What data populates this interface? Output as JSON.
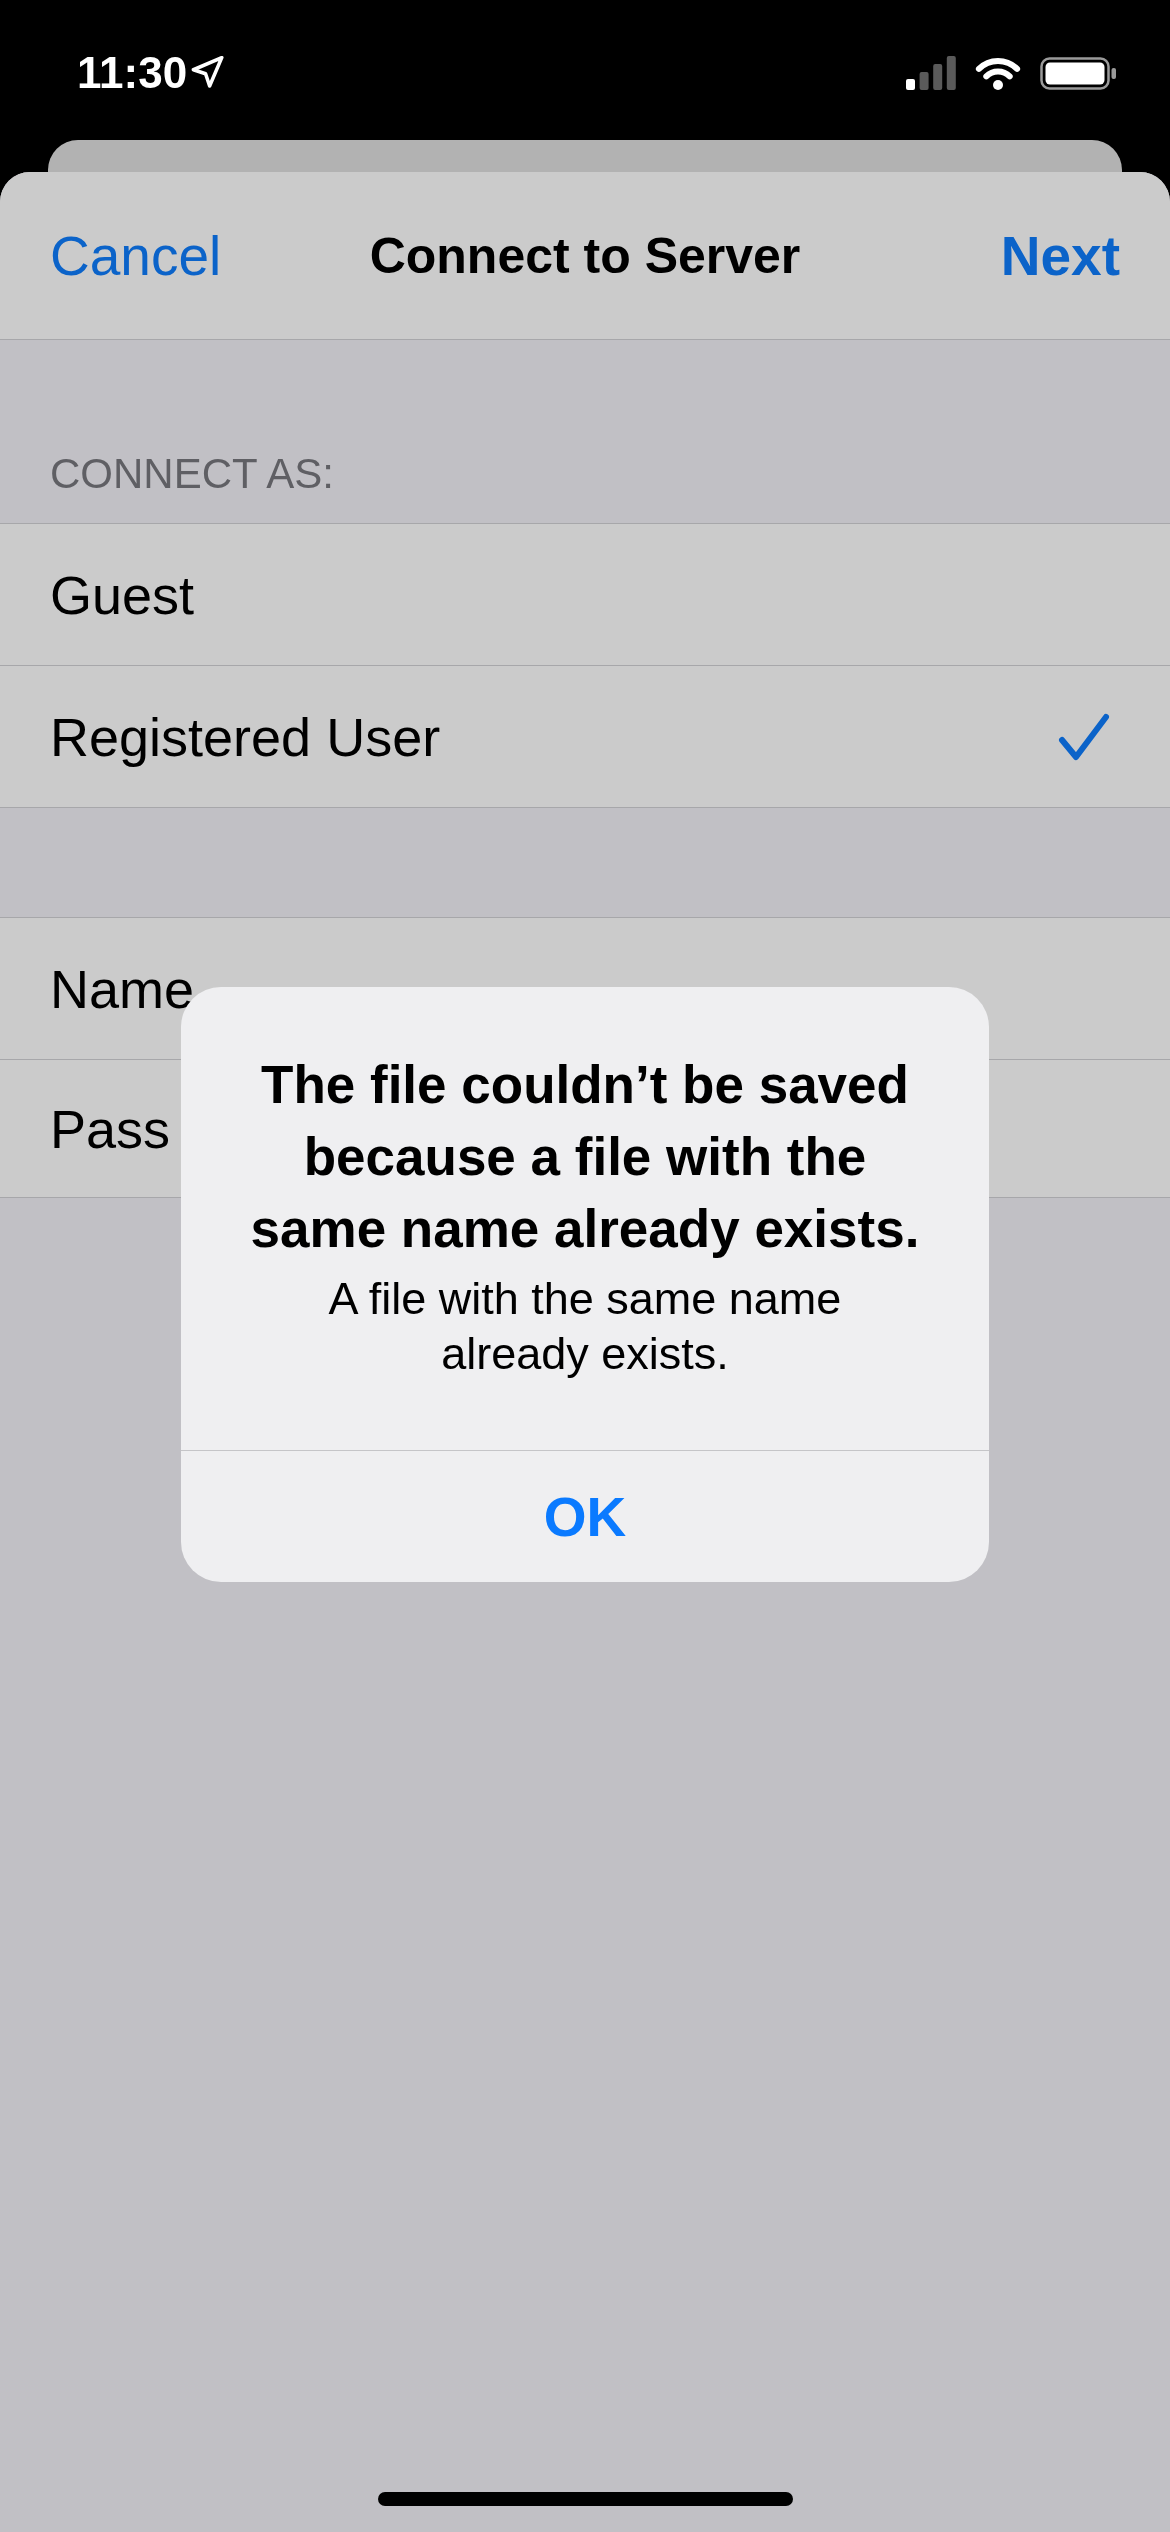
{
  "status_bar": {
    "time": "11:30"
  },
  "nav_bar": {
    "cancel": "Cancel",
    "title": "Connect to Server",
    "next": "Next"
  },
  "connect_as": {
    "header": "CONNECT AS:",
    "options": [
      {
        "label": "Guest",
        "selected": false
      },
      {
        "label": "Registered User",
        "selected": true
      }
    ]
  },
  "credentials": [
    {
      "label": "Name"
    },
    {
      "label": "Pass"
    }
  ],
  "alert": {
    "title": "The file couldn’t be saved because a file with the same name already exists.",
    "message": "A file with the same name already exists.",
    "buttons": [
      "OK"
    ]
  }
}
